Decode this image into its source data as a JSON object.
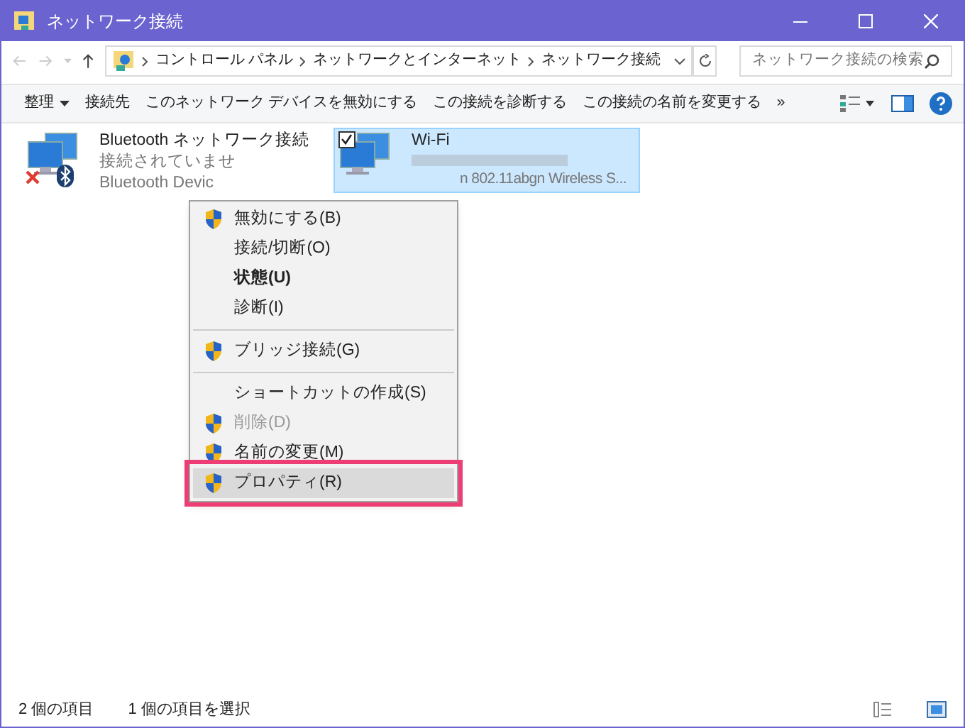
{
  "window": {
    "title": "ネットワーク接続"
  },
  "address": {
    "crumbs": [
      "コントロール パネル",
      "ネットワークとインターネット",
      "ネットワーク接続"
    ]
  },
  "search": {
    "placeholder": "ネットワーク接続の検索"
  },
  "toolbar": [
    "整理",
    "接続先",
    "このネットワーク デバイスを無効にする",
    "この接続を診断する",
    "この接続の名前を変更する",
    "»"
  ],
  "items": [
    {
      "name": "Bluetooth ネットワーク接続",
      "status": "接続されていませ",
      "device": "Bluetooth Devic",
      "kind": "bluetooth",
      "selected": false
    },
    {
      "name": "Wi-Fi",
      "device": "n 802.11abgn Wireless S...",
      "kind": "wifi",
      "selected": true
    }
  ],
  "menu": [
    {
      "label": "無効にする(B)",
      "shield": true,
      "bold": false,
      "disabled": false,
      "selected": false
    },
    {
      "label": "接続/切断(O)",
      "shield": false,
      "bold": false,
      "disabled": false,
      "selected": false
    },
    {
      "label": "状態(U)",
      "shield": false,
      "bold": true,
      "disabled": false,
      "selected": false
    },
    {
      "label": "診断(I)",
      "shield": false,
      "bold": false,
      "disabled": false,
      "selected": false
    },
    {
      "kind": "separator"
    },
    {
      "label": "ブリッジ接続(G)",
      "shield": true,
      "bold": false,
      "disabled": false,
      "selected": false
    },
    {
      "kind": "separator"
    },
    {
      "label": "ショートカットの作成(S)",
      "shield": false,
      "bold": false,
      "disabled": false,
      "selected": false
    },
    {
      "label": "削除(D)",
      "shield": true,
      "bold": false,
      "disabled": true,
      "selected": false
    },
    {
      "label": "名前の変更(M)",
      "shield": true,
      "bold": false,
      "disabled": false,
      "selected": false
    },
    {
      "label": "プロパティ(R)",
      "shield": true,
      "bold": false,
      "disabled": false,
      "selected": true
    }
  ],
  "status_bar": [
    "2 個の項目",
    "1 個の項目を選択"
  ]
}
